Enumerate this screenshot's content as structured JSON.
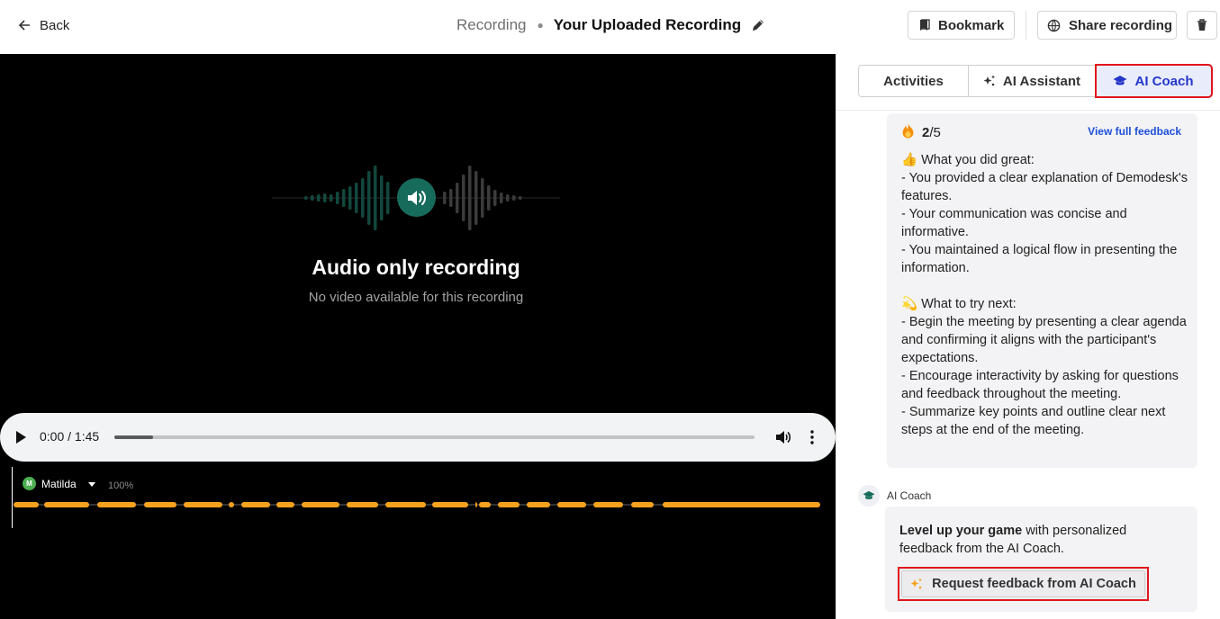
{
  "header": {
    "back_label": "Back",
    "breadcrumb": "Recording",
    "title": "Your Uploaded Recording",
    "bookmark_label": "Bookmark",
    "share_label": "Share recording"
  },
  "stage": {
    "audio_title": "Audio only recording",
    "audio_subtitle": "No video available for this recording",
    "player": {
      "time": "0:00 / 1:45",
      "progress_fraction": 0.06
    },
    "speaker": {
      "initial": "M",
      "name": "Matilda",
      "percent": "100%"
    }
  },
  "panel": {
    "tabs": [
      {
        "label": "Activities"
      },
      {
        "label": "AI Assistant"
      },
      {
        "label": "AI Coach",
        "active": true
      }
    ],
    "feedback": {
      "score": "2",
      "score_total": "/5",
      "view_full_label": "View full feedback",
      "great_heading": "What you did great:",
      "great_items": [
        "- You provided a clear explanation of Demodesk's features.",
        "- Your communication was concise and informative.",
        "- You maintained a logical flow in presenting the information."
      ],
      "next_heading": "What to try next:",
      "next_items": [
        "- Begin the meeting by presenting a clear agenda and confirming it aligns with the participant's expectations.",
        "- Encourage interactivity by asking for questions and feedback throughout the meeting.",
        "- Summarize key points and outline clear next steps at the end of the meeting."
      ]
    },
    "coach_name": "AI Coach",
    "cta": {
      "bold": "Level up your game",
      "rest": " with personalized feedback from the AI Coach.",
      "button_label": "Request feedback from AI Coach"
    }
  },
  "colors": {
    "accent_green": "#176b5b",
    "segment_orange": "#f6a21e",
    "active_tab_blue": "#2537c8",
    "highlight_red": "#e0151d",
    "link_blue": "#1d4ed8"
  }
}
